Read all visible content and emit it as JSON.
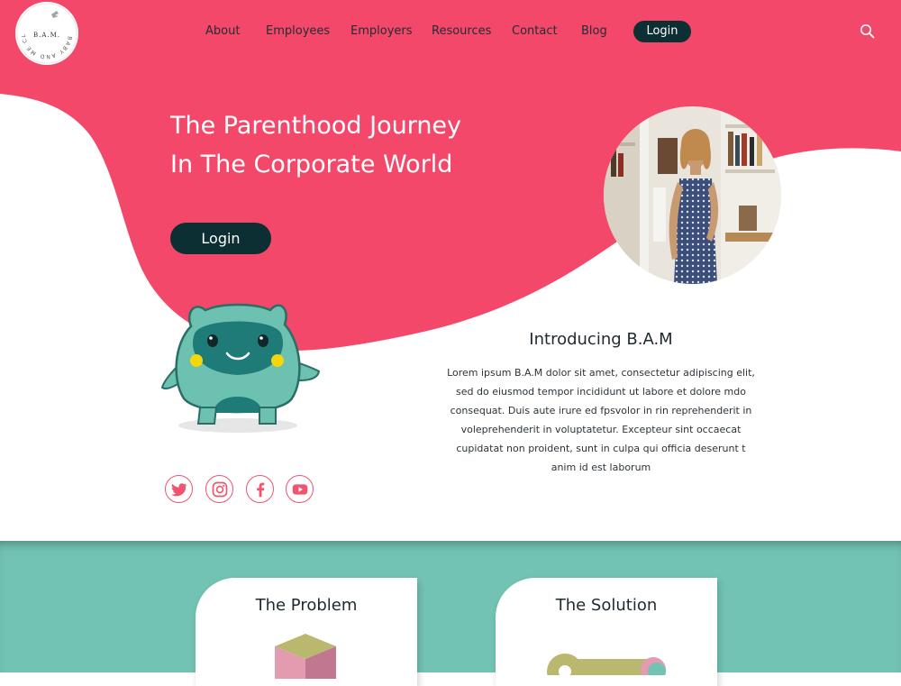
{
  "brand": {
    "logo_top_text": "B.A.M.",
    "logo_ring_text": "BABY AND ME CLUB"
  },
  "nav": {
    "items": [
      {
        "label": "About"
      },
      {
        "label": "Employees"
      },
      {
        "label": "Employers"
      },
      {
        "label": "Resources"
      },
      {
        "label": "Contact"
      },
      {
        "label": "Blog"
      }
    ],
    "login_label": "Login",
    "search_icon": "search-icon"
  },
  "hero": {
    "title_line1": "The Parenthood Journey",
    "title_line2": "In The Corporate World",
    "login_label": "Login"
  },
  "intro": {
    "heading": "Introducing B.A.M",
    "body": "Lorem ipsum B.A.M dolor sit amet, consectetur adipiscing elit, sed do eiusmod tempor incididunt ut labore et dolore mdo consequat. Duis aute irure ed fpsvolor in rin reprehenderit in voleprehenderit in voluptatetur. Excepteur sint occaecat cupidatat non proident, sunt in culpa qui officia deserunt t anim id est laborum"
  },
  "socials": [
    {
      "icon": "twitter-icon"
    },
    {
      "icon": "instagram-icon"
    },
    {
      "icon": "facebook-icon"
    },
    {
      "icon": "youtube-icon"
    }
  ],
  "cards": [
    {
      "title": "The Problem"
    },
    {
      "title": "The Solution"
    }
  ],
  "colors": {
    "brand_pink": "#f4486a",
    "dark_teal": "#0c2f33",
    "section_teal": "#72c3b4",
    "mascot_teal": "#6cc1b0"
  }
}
